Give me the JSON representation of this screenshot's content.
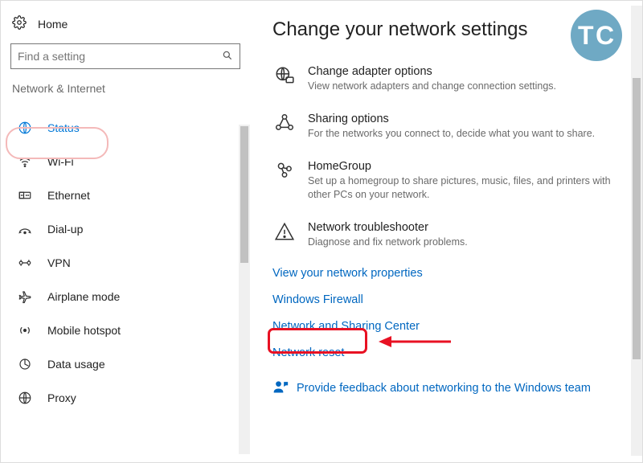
{
  "sidebar": {
    "home": "Home",
    "search_placeholder": "Find a setting",
    "section": "Network & Internet",
    "items": [
      {
        "label": "Status"
      },
      {
        "label": "Wi-Fi"
      },
      {
        "label": "Ethernet"
      },
      {
        "label": "Dial-up"
      },
      {
        "label": "VPN"
      },
      {
        "label": "Airplane mode"
      },
      {
        "label": "Mobile hotspot"
      },
      {
        "label": "Data usage"
      },
      {
        "label": "Proxy"
      }
    ]
  },
  "main": {
    "header": "Change your network settings",
    "options": [
      {
        "title": "Change adapter options",
        "desc": "View network adapters and change connection settings."
      },
      {
        "title": "Sharing options",
        "desc": "For the networks you connect to, decide what you want to share."
      },
      {
        "title": "HomeGroup",
        "desc": "Set up a homegroup to share pictures, music, files, and printers with other PCs on your network."
      },
      {
        "title": "Network troubleshooter",
        "desc": "Diagnose and fix network problems."
      }
    ],
    "links": [
      "View your network properties",
      "Windows Firewall",
      "Network and Sharing Center",
      "Network reset"
    ],
    "feedback": "Provide feedback about networking to the Windows team"
  }
}
